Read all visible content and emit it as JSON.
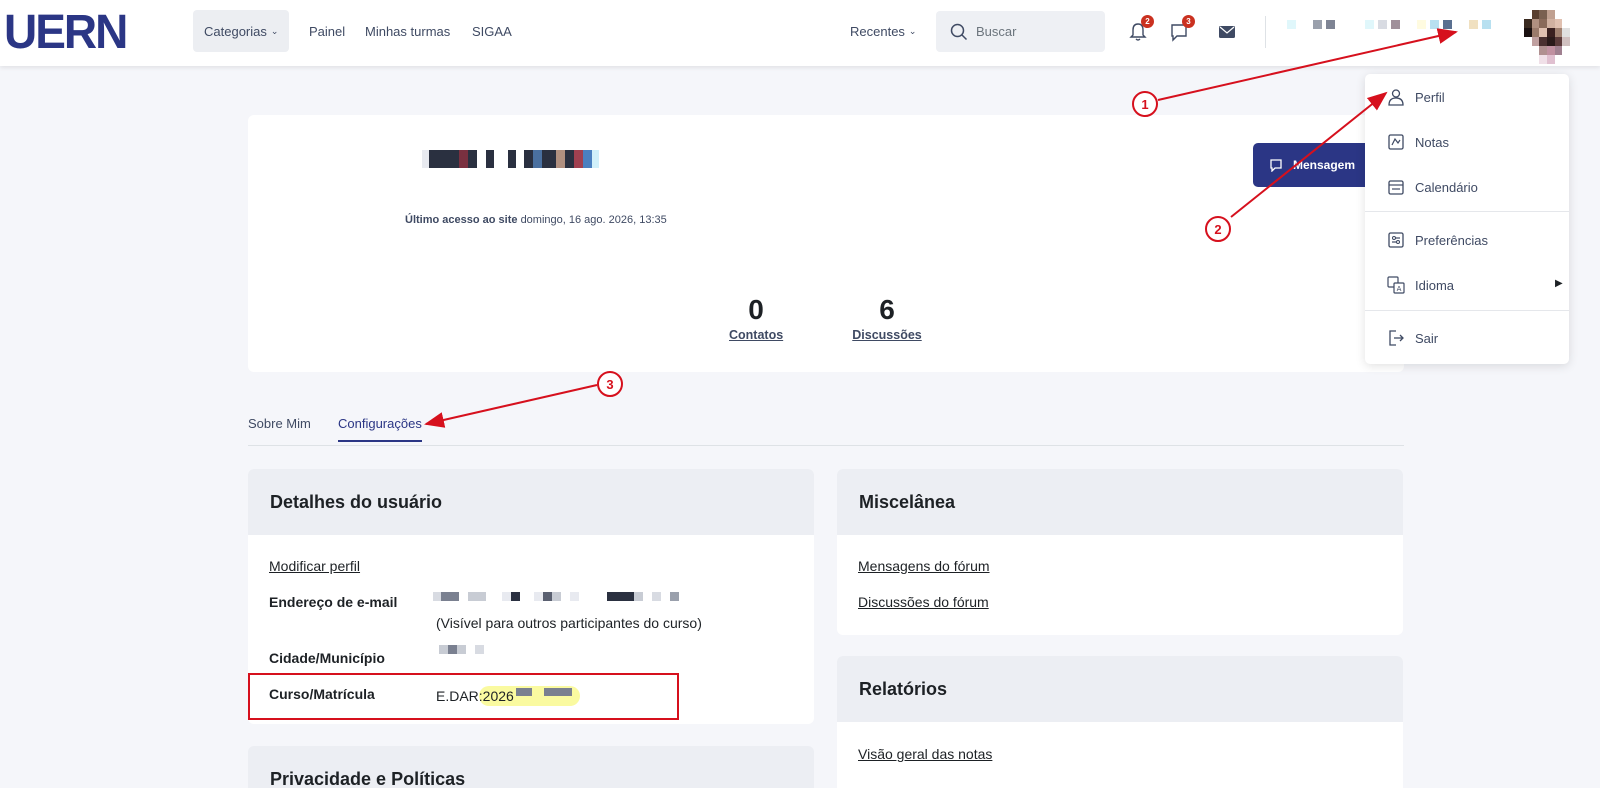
{
  "navbar": {
    "logo": "UERN",
    "categories": "Categorias",
    "painel": "Painel",
    "minhas_turmas": "Minhas turmas",
    "sigaa": "SIGAA",
    "recentes": "Recentes",
    "search_placeholder": "Buscar",
    "notifications_count": "2",
    "messages_count": "3"
  },
  "profile": {
    "last_access_label": "Último acesso ao site",
    "last_access_value": "domingo, 16 ago. 2026, 13:35",
    "message_button": "Mensagem",
    "contacts_count": "0",
    "contacts_label": "Contatos",
    "discussions_count": "6",
    "discussions_label": "Discussões"
  },
  "tabs": {
    "about": "Sobre Mim",
    "settings": "Configurações"
  },
  "user_details": {
    "title": "Detalhes do usuário",
    "edit_profile": "Modificar perfil",
    "email_label": "Endereço de e-mail",
    "email_visibility": "(Visível para outros participantes do curso)",
    "city_label": "Cidade/Município",
    "course_label": "Curso/Matrícula",
    "course_prefix": "E.DAR",
    "course_value": ":2026"
  },
  "privacy": {
    "title": "Privacidade e Políticas"
  },
  "misc": {
    "title": "Miscelânea",
    "forum_posts": "Mensagens do fórum",
    "forum_discussions": "Discussões do fórum"
  },
  "reports": {
    "title": "Relatórios",
    "grades_overview": "Visão geral das notas"
  },
  "user_menu": {
    "profile": "Perfil",
    "grades": "Notas",
    "calendar": "Calendário",
    "preferences": "Preferências",
    "language": "Idioma",
    "logout": "Sair"
  },
  "annotations": {
    "step1": "1",
    "step2": "2",
    "step3": "3"
  },
  "colors": {
    "primary": "#2b3685",
    "annotation": "#d6101d",
    "badge": "#ca3120",
    "highlight": "#fafaa0"
  }
}
